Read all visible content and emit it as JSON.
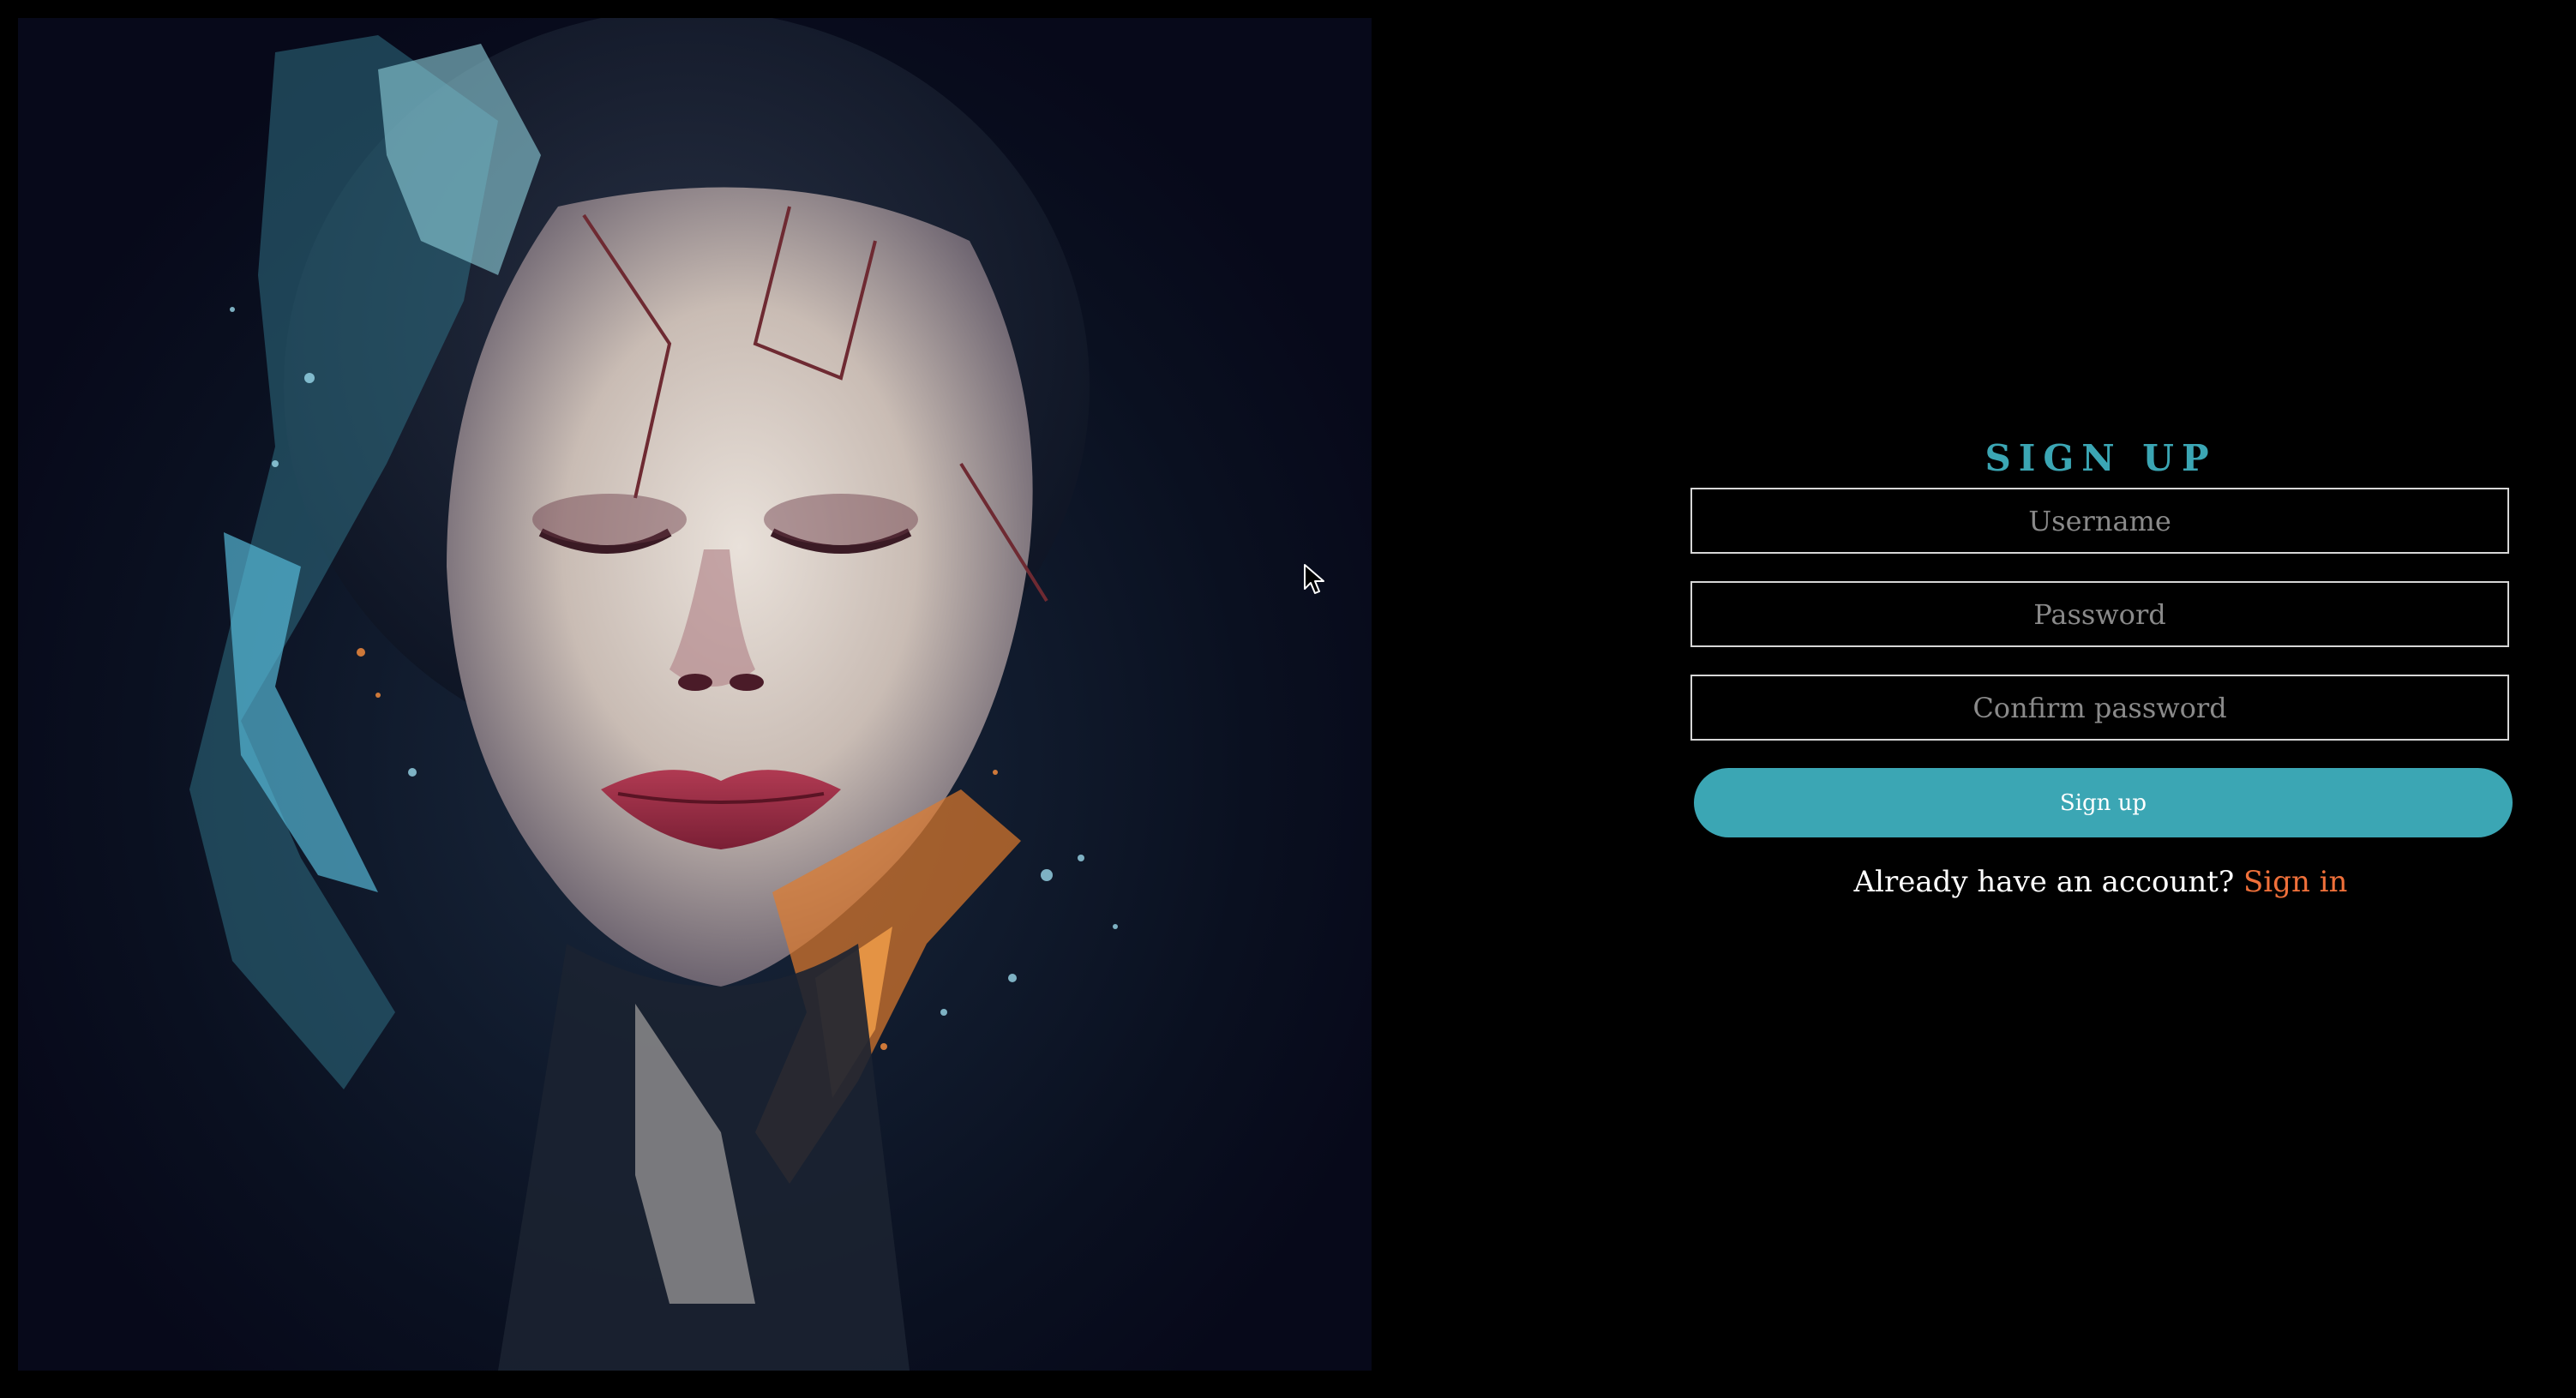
{
  "artwork": {
    "alt": "Abstract portrait artwork"
  },
  "signup": {
    "title": "SIGN UP",
    "username_placeholder": "Username",
    "password_placeholder": "Password",
    "confirm_placeholder": "Confirm password",
    "submit_label": "Sign up",
    "footer_text": "Already have an account?",
    "signin_link": "Sign in"
  },
  "icons": {
    "cursor": "mouse-pointer-icon"
  },
  "colors": {
    "background": "#000000",
    "accent_teal": "#3ba6b4",
    "link_orange": "#f0703a",
    "field_border": "#d6d6d6",
    "placeholder": "#8a8a8a"
  }
}
